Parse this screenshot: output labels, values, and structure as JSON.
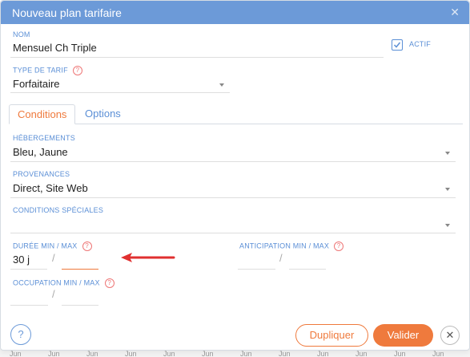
{
  "dialog": {
    "title": "Nouveau plan tarifaire",
    "close_glyph": "✕"
  },
  "fields": {
    "nom": {
      "label": "NOM",
      "value": "Mensuel Ch Triple"
    },
    "actif": {
      "label": "ACTIF",
      "checked": true
    },
    "type_tarif": {
      "label": "TYPE DE TARIF",
      "help": "?",
      "value": "Forfaitaire"
    }
  },
  "tabs": [
    {
      "label": "Conditions",
      "active": true
    },
    {
      "label": "Options",
      "active": false
    }
  ],
  "conditions": {
    "hebergements": {
      "label": "HÉBERGEMENTS",
      "value": "Bleu, Jaune"
    },
    "provenances": {
      "label": "PROVENANCES",
      "value": "Direct, Site Web"
    },
    "conditions_speciales": {
      "label": "CONDITIONS SPÉCIALES",
      "value": ""
    },
    "duree": {
      "label": "DURÉE MIN / MAX",
      "help": "?",
      "min": "30 j",
      "max": "",
      "separator": "/"
    },
    "anticipation": {
      "label": "ANTICIPATION MIN / MAX",
      "help": "?",
      "min": "",
      "max": "",
      "separator": "/"
    },
    "occupation": {
      "label": "OCCUPATION MIN / MAX",
      "help": "?",
      "min": "",
      "max": "",
      "separator": "/"
    }
  },
  "footer": {
    "help_label": "?",
    "duplicate_label": "Dupliquer",
    "validate_label": "Valider",
    "close_label": "✕"
  },
  "background_strip": [
    "Jun",
    "Jun",
    "Jun",
    "Jun",
    "Jun",
    "Jun",
    "Jun",
    "Jun",
    "Jun",
    "Jun",
    "Jun",
    "Jun"
  ],
  "colors": {
    "titlebar": "#6c9ad8",
    "label": "#5b8fd6",
    "accent": "#ef7a3d",
    "arrow": "#e03030"
  }
}
